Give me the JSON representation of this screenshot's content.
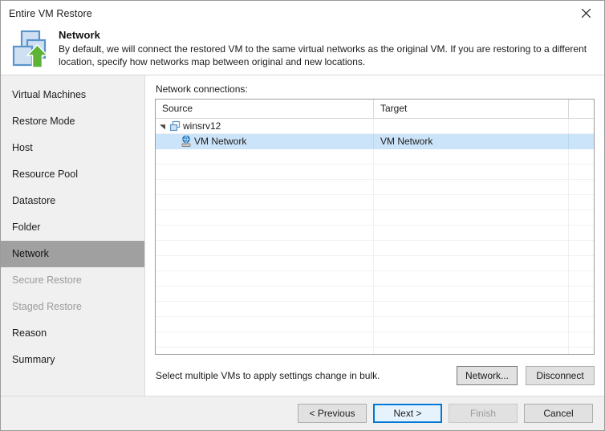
{
  "window": {
    "title": "Entire VM Restore",
    "close_icon": "close-icon"
  },
  "header": {
    "icon": "vm-restore-icon",
    "title": "Network",
    "description": "By default, we will connect the restored VM to the same virtual networks as the original VM. If you are restoring to a different location, specify how networks map between original and new locations."
  },
  "sidebar": {
    "items": [
      {
        "label": "Virtual Machines",
        "state": "normal"
      },
      {
        "label": "Restore Mode",
        "state": "normal"
      },
      {
        "label": "Host",
        "state": "normal"
      },
      {
        "label": "Resource Pool",
        "state": "normal"
      },
      {
        "label": "Datastore",
        "state": "normal"
      },
      {
        "label": "Folder",
        "state": "normal"
      },
      {
        "label": "Network",
        "state": "selected"
      },
      {
        "label": "Secure Restore",
        "state": "disabled"
      },
      {
        "label": "Staged Restore",
        "state": "disabled"
      },
      {
        "label": "Reason",
        "state": "normal"
      },
      {
        "label": "Summary",
        "state": "normal"
      }
    ]
  },
  "main": {
    "grid_label": "Network connections:",
    "columns": {
      "source": "Source",
      "target": "Target",
      "extra": ""
    },
    "rows": [
      {
        "type": "group",
        "expanded": true,
        "icon": "vm-icon",
        "source": "winsrv12",
        "target": "",
        "selected": false
      },
      {
        "type": "child",
        "icon": "network-adapter-icon",
        "source": "VM Network",
        "target": "VM Network",
        "selected": true
      }
    ],
    "empty_row_count": 14,
    "bulk_hint": "Select multiple VMs to apply settings change in bulk.",
    "network_button": "Network...",
    "disconnect_button": "Disconnect"
  },
  "footer": {
    "previous": "< Previous",
    "next": "Next >",
    "finish": "Finish",
    "cancel": "Cancel"
  },
  "colors": {
    "accent": "#0078d7",
    "selection": "#cce4fa",
    "sidebar_selected": "#a0a0a0",
    "chrome": "#f0f0f0",
    "icon_blue": "#7ba7d7",
    "icon_green": "#5cb335"
  }
}
